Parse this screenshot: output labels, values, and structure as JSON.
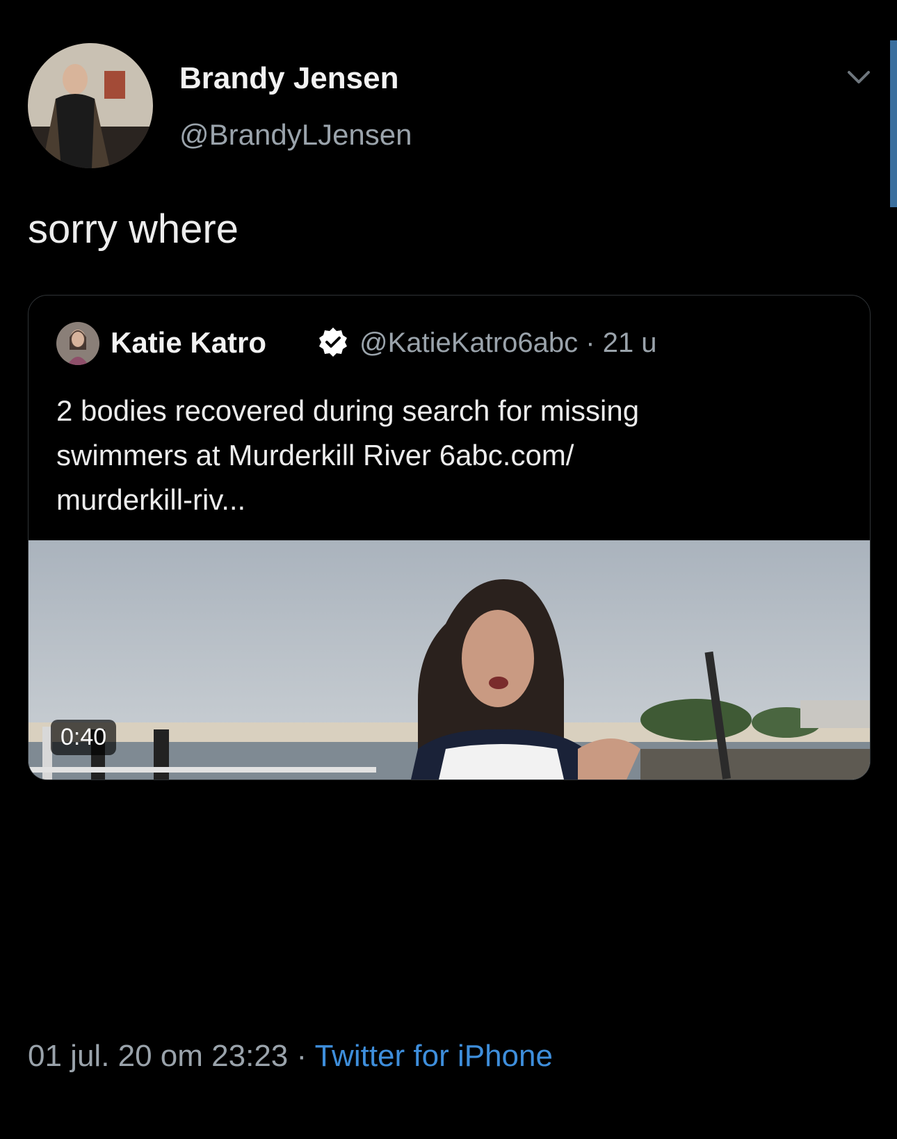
{
  "author": {
    "name": "Brandy Jensen",
    "handle": "@BrandyLJensen"
  },
  "tweet": {
    "text": "sorry where"
  },
  "quoted_tweet": {
    "author_name": "Katie Katro",
    "author_handle": "@KatieKatro6abc",
    "separator": "·",
    "age": "21 u",
    "text_line1": "2 bodies recovered during search for missing",
    "text_line2": "swimmers at Murderkill River 6abc.com/",
    "text_line3": "murderkill-riv...",
    "video_duration": "0:40"
  },
  "footer": {
    "timestamp": "01 jul. 20 om 23:23",
    "separator": "·",
    "source": "Twitter for iPhone"
  },
  "colors": {
    "background": "#000000",
    "link": "#3e8edb",
    "verified": "#ffffff",
    "secondary_text": "#9aa3ab"
  },
  "icons": [
    "chevron-down-icon",
    "verified-badge-icon"
  ]
}
